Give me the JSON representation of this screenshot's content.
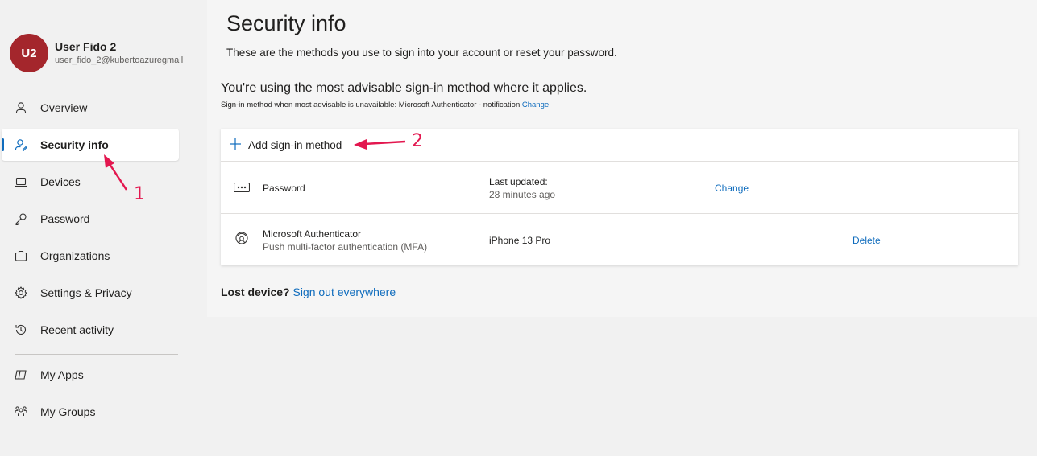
{
  "profile": {
    "initials": "U2",
    "name": "User Fido 2",
    "email": "user_fido_2@kubertoazuregmail"
  },
  "sidebar": {
    "items": [
      {
        "label": "Overview",
        "icon": "person-icon"
      },
      {
        "label": "Security info",
        "icon": "person-key-icon",
        "active": true
      },
      {
        "label": "Devices",
        "icon": "laptop-icon"
      },
      {
        "label": "Password",
        "icon": "key-icon"
      },
      {
        "label": "Organizations",
        "icon": "briefcase-icon"
      },
      {
        "label": "Settings & Privacy",
        "icon": "gear-icon"
      },
      {
        "label": "Recent activity",
        "icon": "history-icon"
      }
    ],
    "secondary_items": [
      {
        "label": "My Apps",
        "icon": "apps-icon"
      },
      {
        "label": "My Groups",
        "icon": "groups-icon"
      }
    ]
  },
  "main": {
    "title": "Security info",
    "subtitle": "These are the methods you use to sign into your account or reset your password.",
    "advisable_heading": "You're using the most advisable sign-in method where it applies.",
    "advisable_sub": "Sign-in method when most advisable is unavailable: Microsoft Authenticator - notification",
    "advisable_change": "Change",
    "add_method_label": "Add sign-in method",
    "methods": [
      {
        "name": "Password",
        "icon": "password-dots-icon",
        "detail_label": "Last updated:",
        "detail_value": "28 minutes ago",
        "action": "Change"
      },
      {
        "name": "Microsoft Authenticator",
        "sub": "Push multi-factor authentication (MFA)",
        "icon": "authenticator-icon",
        "detail_value": "iPhone 13 Pro",
        "action": "Delete"
      }
    ],
    "lost_device_label": "Lost device?",
    "sign_out_everywhere": "Sign out everywhere"
  },
  "annotations": {
    "step1": "1",
    "step2": "2"
  },
  "colors": {
    "accent": "#0f6cbd",
    "avatar": "#a4262c",
    "annotation": "#e3174f"
  }
}
